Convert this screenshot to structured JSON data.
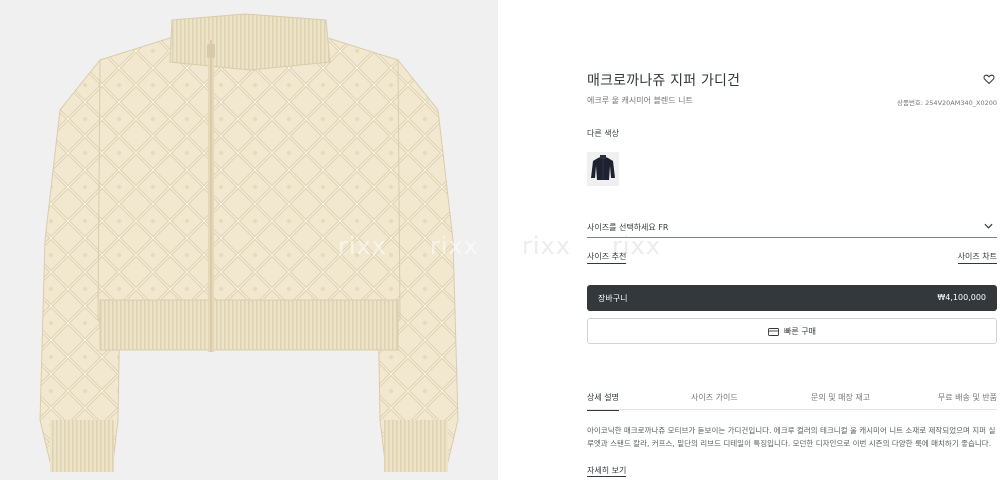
{
  "product": {
    "title": "매크로까나쥬 지퍼 가디건",
    "subtitle": "에크루 울 캐시미어 블렌드 니트",
    "reference": "상품번호: 254V20AM340_X0200",
    "image_alt": "ecru-quilted-zip-cardigan"
  },
  "watermark": {
    "text": "rixx"
  },
  "colors": {
    "label": "다른 색상",
    "swatches": [
      {
        "name": "navy-cardigan-thumbnail"
      }
    ]
  },
  "size": {
    "select_label": "사이즈를 선택하세요 FR",
    "recommend_link": "사이즈 추천",
    "chart_link": "사이즈 차트"
  },
  "actions": {
    "cart_label": "장바구니",
    "cart_price": "₩4,100,000",
    "quick_buy_label": "빠른 구매"
  },
  "tabs": [
    {
      "label": "상세 설명",
      "active": true
    },
    {
      "label": "사이즈 가이드",
      "active": false
    },
    {
      "label": "문의 및 매장 재고",
      "active": false
    },
    {
      "label": "무료 배송 및 반품",
      "active": false
    }
  ],
  "description": {
    "text": "아이코닉한 매크로까나쥬 모티브가 돋보이는 가디건입니다. 에크루 컬러의 테크니컬 울 캐시미어 니트 소재로 제작되었으며 지퍼 실루엣과 스탠드 칼라, 커프스, 밑단의 리브드 디테일이 특징입니다. 모던한 디자인으로 이번 시즌의 다양한 룩에 매치하기 좋습니다.",
    "more_link": "자세히 보기"
  },
  "style_colors": {
    "image_bg": "#f0f0f0",
    "garment": "#efe6cd",
    "dark_button": "#33383c"
  }
}
